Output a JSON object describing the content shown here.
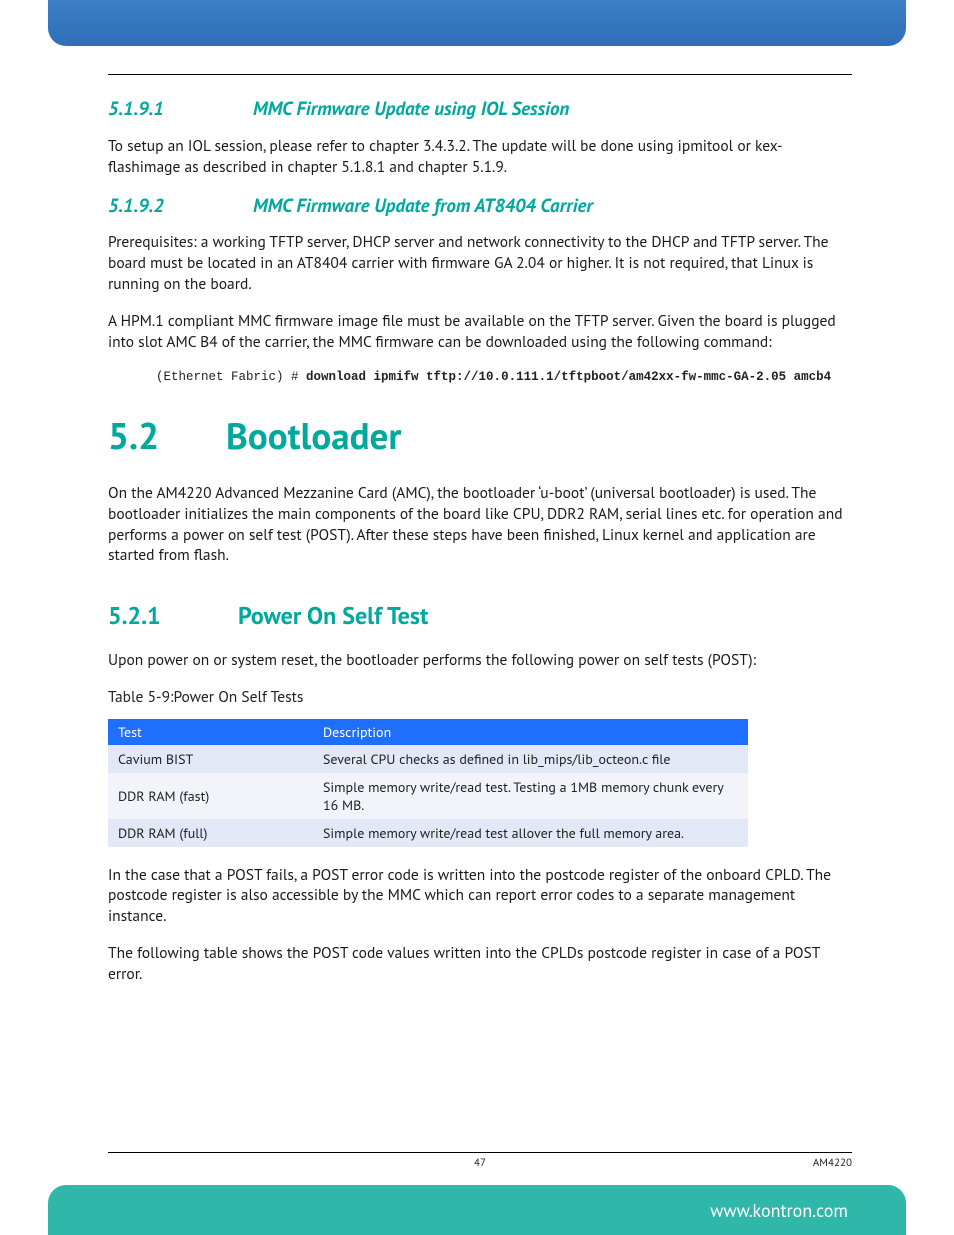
{
  "sections": {
    "s1": {
      "num": "5.1.9.1",
      "title": "MMC Firmware Update using IOL Session"
    },
    "s1_p1": "To setup an IOL session, please refer to chapter 3.4.3.2. The update will be done using ipmitool or kex-flashimage as described in chapter 5.1.8.1 and chapter 5.1.9.",
    "s2": {
      "num": "5.1.9.2",
      "title": "MMC Firmware Update from AT8404 Carrier"
    },
    "s2_p1": "Prerequisites: a working TFTP server, DHCP server and network connectivity to the DHCP and TFTP server. The board must be located in an AT8404 carrier with firmware GA 2.04 or higher. It is not required, that Linux is running on the board.",
    "s2_p2": "A HPM.1 compliant MMC firmware image file must be available on the TFTP server. Given the board is plugged into slot AMC B4 of the carrier, the MMC firmware can be downloaded using the following command:",
    "code_prompt": "(Ethernet Fabric) # ",
    "code_cmd": "download ipmifw tftp://10.0.111.1/tftpboot/am42xx-fw-mmc-GA-2.05 amcb4",
    "h2": {
      "num": "5.2",
      "title": "Bootloader"
    },
    "h2_p1": "On the AM4220 Advanced Mezzanine Card (AMC), the bootloader ‘u-boot’ (universal bootloader) is used. The bootloader initializes the main components of the board like CPU, DDR2 RAM, serial lines etc. for operation and performs a power on self test (POST). After these steps have been finished, Linux kernel and application are started from flash.",
    "h3": {
      "num": "5.2.1",
      "title": "Power On Self Test"
    },
    "h3_p1": "Upon power on or system reset, the bootloader performs the following power on self tests (POST):",
    "table_caption": "Table 5-9:Power On Self Tests",
    "table_after_p1": "In the case that a POST fails, a POST error code is written into the postcode register of the onboard CPLD. The postcode register is also accessible by the MMC which can report error codes to a separate management instance.",
    "table_after_p2": "The following table shows the POST code values written into the CPLDs postcode register in case of a POST error."
  },
  "chart_data": {
    "type": "table",
    "columns": [
      "Test",
      "Description"
    ],
    "rows": [
      {
        "test": "Cavium BIST",
        "desc": "Several CPU checks as defined in lib_mips/lib_octeon.c file"
      },
      {
        "test": "DDR RAM (fast)",
        "desc": "Simple memory write/read test. Testing a 1MB memory chunk every 16 MB."
      },
      {
        "test": "DDR RAM (full)",
        "desc": "Simple memory write/read test allover the full memory area."
      }
    ]
  },
  "footer": {
    "page": "47",
    "model": "AM4220",
    "url": "www.kontron.com"
  }
}
